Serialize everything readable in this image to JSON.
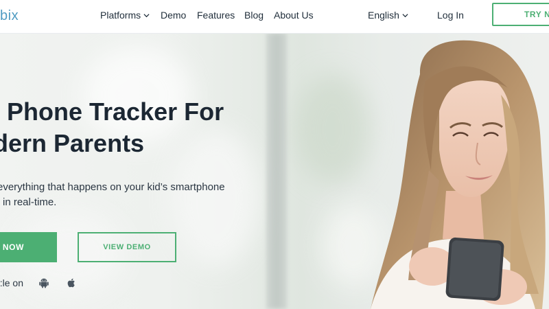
{
  "header": {
    "logo": "bix",
    "nav": [
      {
        "label": "Platforms",
        "has_dropdown": true
      },
      {
        "label": "Demo",
        "has_dropdown": false
      },
      {
        "label": "Features",
        "has_dropdown": false
      },
      {
        "label": "Blog",
        "has_dropdown": false
      },
      {
        "label": "About Us",
        "has_dropdown": false
      }
    ],
    "language": "English",
    "login": "Log In",
    "cta": "TRY NO"
  },
  "hero": {
    "headline": [
      "l Phone Tracker For",
      "dern Parents"
    ],
    "subtext": [
      "everything that happens on your kid’s smartphone",
      "in real-time."
    ],
    "primary_button": "Y NOW",
    "secondary_button": "VIEW DEMO",
    "available_label": "le on:",
    "platform_icons": [
      "android-icon",
      "apple-icon"
    ]
  },
  "colors": {
    "accent": "#4caf73",
    "logo": "#4f9bc2",
    "text_dark": "#1c2733"
  }
}
